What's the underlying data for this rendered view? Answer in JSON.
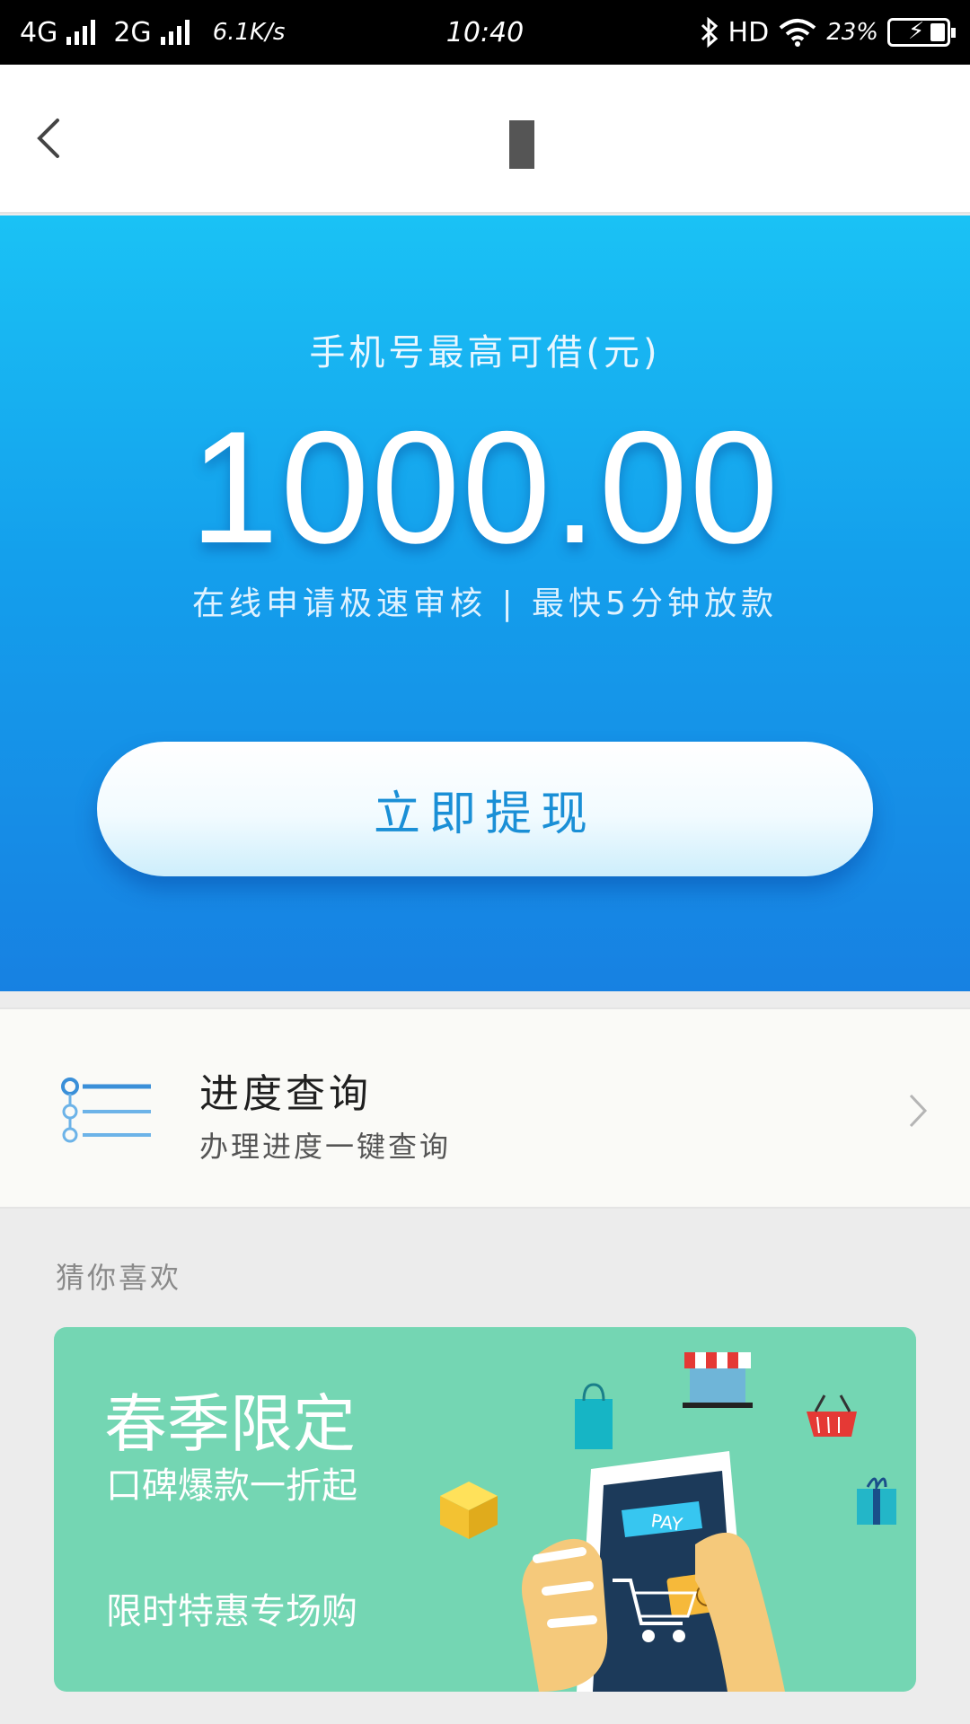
{
  "status_bar": {
    "network1": "4G",
    "network2": "2G",
    "speed": "6.1K/s",
    "time": "10:40",
    "hd": "HD",
    "battery": "23%"
  },
  "hero": {
    "label": "手机号最高可借(元)",
    "amount": "1000.00",
    "subtitle": "在线申请极速审核 | 最快5分钟放款",
    "cta_label": "立即提现"
  },
  "progress": {
    "title": "进度查询",
    "subtitle": "办理进度一键查询"
  },
  "recommend": {
    "section_title": "猜你喜欢",
    "banner": {
      "headline": "春季限定",
      "line1": "口碑爆款一折起",
      "line2": "限时特惠专场购",
      "pay_label": "PAY"
    }
  },
  "colors": {
    "hero_top": "#1ac2f5",
    "hero_bottom": "#1781e2",
    "cta_text": "#1a8fd6",
    "banner_bg": "#74d6b3"
  }
}
